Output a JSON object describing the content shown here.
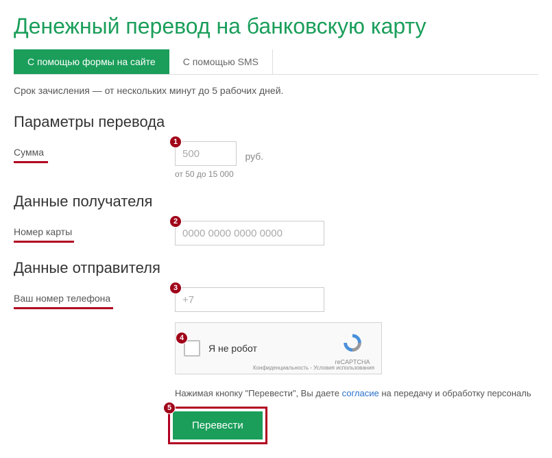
{
  "title": "Денежный перевод на банковскую карту",
  "tabs": {
    "form": "С помощью формы на сайте",
    "sms": "С помощью SMS"
  },
  "deadline": "Срок зачисления — от нескольких минут до 5 рабочих дней.",
  "section_params": "Параметры перевода",
  "section_recipient": "Данные получателя",
  "section_sender": "Данные отправителя",
  "sum": {
    "label": "Сумма",
    "placeholder": "500",
    "suffix": "руб.",
    "hint": "от 50 до 15 000"
  },
  "card": {
    "label": "Номер карты",
    "placeholder": "0000 0000 0000 0000"
  },
  "phone": {
    "label": "Ваш номер телефона",
    "placeholder": "+7"
  },
  "captcha": {
    "label": "Я не робот",
    "brand": "reCAPTCHA",
    "links": "Конфиденциальность - Условия использования"
  },
  "consent_prefix": "Нажимая кнопку \"Перевести\", Вы даете ",
  "consent_link": "согласие",
  "consent_suffix": " на передачу и обработку персональ",
  "submit": "Перевести",
  "markers": {
    "m1": "1",
    "m2": "2",
    "m3": "3",
    "m4": "4",
    "m5": "5"
  }
}
